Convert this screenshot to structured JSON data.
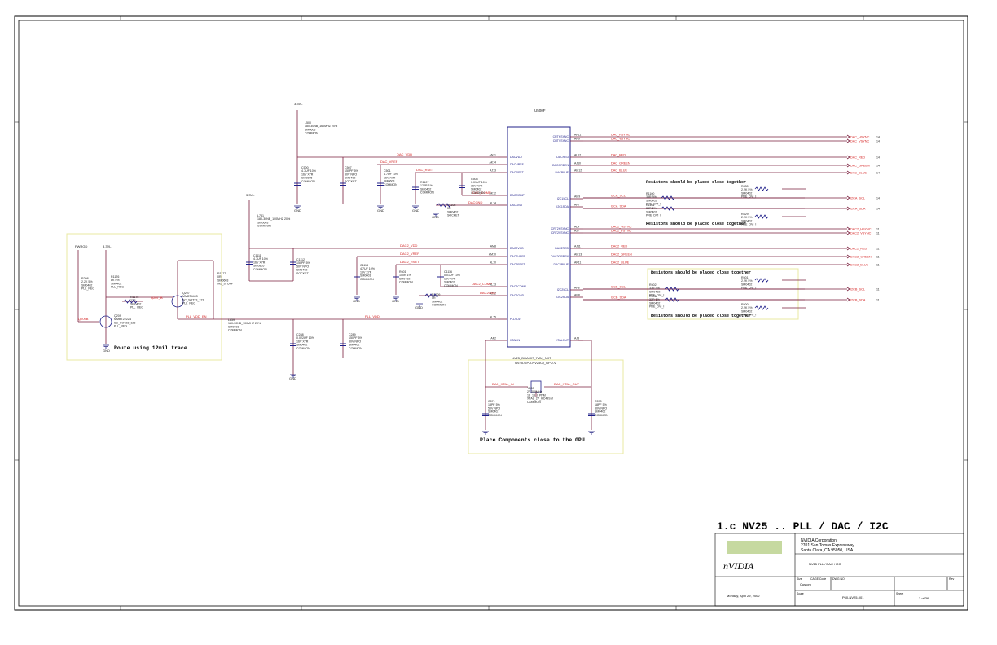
{
  "title_block": {
    "sheet_title": "1.c  NV25 .. PLL / DAC / I2C",
    "company": "NVIDIA Corporation",
    "address1": "2701 San Tomas Expressway",
    "address2": "Santa Clara, CA 95050, USA",
    "logo": "nVIDIA",
    "page_name": "NV25 PLL / DAC / I2C",
    "size_label": "Size",
    "size_value": "Custom",
    "cage_label": "CAGE Code",
    "dwg_label": "DWG NO",
    "rev_label": "Rev",
    "scale_label": "Scale",
    "date": "Monday, April 29, 2002",
    "dwg_value": "P60-NV25-001",
    "sheet_label": "Sheet",
    "sheet_value": "3   of   36"
  },
  "notes": {
    "route": "Route using 12mil trace.",
    "place": "Place Components close to the GPU",
    "resist1": "Resistors should be placed close together",
    "resist2": "Resistors should be placed close together",
    "resist3": "Resistors should be placed close together",
    "resist4": "Resistors should be placed close together"
  },
  "gpu": {
    "ref": "U500F",
    "part1": "NV25_BGA907_7MM_NKT",
    "part2": "NV25-GPU-NV2500_GPU-V",
    "left_pins": [
      {
        "num": "AN11",
        "name": "DACVDD"
      },
      {
        "num": "AK14",
        "name": "DACVREF"
      },
      {
        "num": "AJ13",
        "name": "DACRSET"
      },
      {
        "num": "AK12",
        "name": "DACCOMP"
      },
      {
        "num": "AL14",
        "name": "DACGND"
      },
      {
        "num": "AM8",
        "name": "DAC2VDD"
      },
      {
        "num": "AM10",
        "name": "DAC2VREF"
      },
      {
        "num": "AL10",
        "name": "DAC2RSET"
      },
      {
        "num": "AL13",
        "name": "DAC2COMP"
      },
      {
        "num": "AJ12",
        "name": "DAC2GND"
      },
      {
        "num": "AL15",
        "name": "PLLVDD"
      },
      {
        "num": "AP2",
        "name": "XTALIN"
      }
    ],
    "right_pins": [
      {
        "num": "AP11",
        "name": "CRTHSYNC"
      },
      {
        "num": "AN9",
        "name": "CRTVSYNC"
      },
      {
        "num": "AL12",
        "name": "DACRED"
      },
      {
        "num": "AJ10",
        "name": "DACGREEN"
      },
      {
        "num": "AM12",
        "name": "DACBLUE"
      },
      {
        "num": "AM9",
        "name": "I2C1SCL"
      },
      {
        "num": "AP7",
        "name": "I2C1SDA"
      },
      {
        "num": "AL4",
        "name": "CRT2HSYNC"
      },
      {
        "num": "AJ7",
        "name": "CRT2VSYNC"
      },
      {
        "num": "AJ11",
        "name": "DAC2RED"
      },
      {
        "num": "AM13",
        "name": "DAC2GREEN"
      },
      {
        "num": "AK11",
        "name": "DAC2BLUE"
      },
      {
        "num": "AP8",
        "name": "I2C2SCL"
      },
      {
        "num": "AN8",
        "name": "I2C2SDA"
      },
      {
        "num": "AJ8",
        "name": "XTALOUT"
      }
    ]
  },
  "outputs": [
    {
      "net": "DAC_HSYNC",
      "port": "DAC_HSYNC",
      "pg": "14"
    },
    {
      "net": "DAC_VSYNC",
      "port": "DAC_VSYNC",
      "pg": "14"
    },
    {
      "net": "DAC_RED",
      "port": "DAC_RED",
      "pg": "14"
    },
    {
      "net": "DAC_GREEN",
      "port": "DAC_GREEN",
      "pg": "14"
    },
    {
      "net": "DAC_BLUE",
      "port": "DAC_BLUE",
      "pg": "14"
    },
    {
      "net": "I2CA_SCL",
      "port": "I2CA_SCL",
      "pg": "14"
    },
    {
      "net": "I2CA_SDA",
      "port": "I2CA_SDA",
      "pg": "14"
    },
    {
      "net": "DAC2_HSYNC",
      "port": "DAC2_HSYNC",
      "pg": "11"
    },
    {
      "net": "DAC2_VSYNC",
      "port": "DAC2_VSYNC",
      "pg": "11"
    },
    {
      "net": "DAC2_RED",
      "port": "DAC2_RED",
      "pg": "11"
    },
    {
      "net": "DAC2_GREEN",
      "port": "DAC2_GREEN",
      "pg": "11"
    },
    {
      "net": "DAC2_BLUE",
      "port": "DAC2_BLUE",
      "pg": "11"
    },
    {
      "net": "I2CB_SCL",
      "port": "I2CB_SCL",
      "pg": "11"
    },
    {
      "net": "I2CB_SDA",
      "port": "I2CB_SDA",
      "pg": "11"
    }
  ],
  "nets": {
    "dac_vdd": "DAC_VDD",
    "dac_vref": "DAC_VREF",
    "dac_rset": "DAC_RSET",
    "dac_comp": "DAC_COMP",
    "dacgnd": "DACGND",
    "dac2_vdd": "DAC2_VDD",
    "dac2_vref": "DAC2_VREF",
    "dac2_rset": "DAC2_RSET",
    "dac2_comp": "DAC2_COMP",
    "dac2gnd": "DAC2GND",
    "pll_vdd": "PLL_VDD",
    "pll_vdd_en": "PLL_VDD_EN",
    "xtal_in": "DAC_XTAL_IN",
    "xtal_out": "DAC_XTAL_OUT",
    "pwrgd": "PWRGD",
    "q209b": "Q209B",
    "q207": "Q207_B",
    "p33v_a": "3.3VL",
    "p33v_b": "3.3VL",
    "p33v_c": "3.3VL",
    "p33v_d": "3.3VL",
    "pwrgd_port": "PWRGD",
    "gnd": "GND",
    "p5v": "5V",
    "sockel": "SOCKET",
    "common": "COMMON"
  },
  "components": {
    "l500": {
      "ref": "L500",
      "v": "180-30NB_160MHZ",
      "t": "20%",
      "p": "SM0603",
      "s": "COMMON"
    },
    "l731": {
      "ref": "L731",
      "v": "180-30NB_100MHZ",
      "t": "20%",
      "p": "SM0603",
      "s": "COMMON"
    },
    "l859": {
      "ref": "L859",
      "v": "180-30NB_100MHZ",
      "t": "20%",
      "p": "SM0603",
      "s": "COMMON"
    },
    "c500": {
      "ref": "C500",
      "v": "4.7UF",
      "t": "10%",
      "x": "16V  X7R",
      "p": "SM0805",
      "s": "COMMON"
    },
    "c507": {
      "ref": "C507",
      "v": "150PF",
      "t": "5%",
      "x": "50V  NPO",
      "p": "SM0402",
      "s": "SOCKET"
    },
    "c501": {
      "ref": "C501",
      "v": "4.7UF",
      "t": "10%",
      "x": "16V  X7R",
      "p": "SM0603",
      "s": "COMMON"
    },
    "r1107": {
      "ref": "R1107",
      "v": "124R",
      "t": "1%",
      "p": "SM0402",
      "s": "COMMON"
    },
    "c508": {
      "ref": "C508",
      "v": "0.01UF",
      "t": "10%",
      "x": "16V  X7R",
      "p": "SM0402",
      "s": "COMMON"
    },
    "r1108": {
      "ref": "R1108",
      "v": "0R",
      "p": "SM0402",
      "s": "SOCKET"
    },
    "c1111": {
      "ref": "C1111",
      "v": "4.7UF",
      "t": "10%",
      "x": "16V  X7R",
      "p": "SM0805",
      "s": "COMMON"
    },
    "c1112": {
      "ref": "C1112",
      "v": "150PF",
      "t": "5%",
      "x": "50V  NPO",
      "p": "SM0402",
      "s": "SOCKET"
    },
    "c1114": {
      "ref": "C1114",
      "v": "4.7UF",
      "t": "10%",
      "x": "16V  X7R",
      "p": "SM0603",
      "s": "COMMON"
    },
    "r601": {
      "ref": "R601",
      "v": "150R",
      "t": "1%",
      "p": "SM0402",
      "s": "COMMON"
    },
    "c1116": {
      "ref": "C1116",
      "v": "0.01UF",
      "t": "10%",
      "x": "16V  X7R",
      "p": "SM0402",
      "s": "COMMON"
    },
    "r1109": {
      "ref": "R1109",
      "v": "0R",
      "p": "SM0402",
      "s": "COMMON"
    },
    "c288": {
      "ref": "C288",
      "v": "0.022UF",
      "t": "10%",
      "x": "16V  X7R",
      "p": "SM0402",
      "s": "COMMON"
    },
    "c289": {
      "ref": "C289",
      "v": "150PF",
      "t": "5%",
      "x": "50V  NPO",
      "p": "SM0402",
      "s": "COMMON"
    },
    "r208": {
      "ref": "R208",
      "v": "2.2K",
      "t": "5%",
      "p": "SM0402",
      "s": "PLL_REG"
    },
    "r1176": {
      "ref": "R1176",
      "v": "8K",
      "t": "5%",
      "p": "SM0402",
      "s": "PLL_REG"
    },
    "r1175": {
      "ref": "R1175",
      "v": "22R",
      "p": "SM0402",
      "s": "PLL_REG"
    },
    "q209": {
      "ref": "Q209",
      "v": "MMBT2222A",
      "p": "SC_SOT23_123",
      "s": "PLL_REG"
    },
    "q207": {
      "ref": "Q207",
      "v": "MMBT4403",
      "p": "SC_SOT23_123",
      "s": "PLL_REG"
    },
    "r1177": {
      "ref": "R1177",
      "v": "0R",
      "p": "SM0603",
      "s": "NO_STUFF"
    },
    "c571": {
      "ref": "C571",
      "v": "18PF",
      "t": "5%",
      "x": "50V  NPO",
      "p": "SM0402",
      "s": "COMMON"
    },
    "c570": {
      "ref": "C570",
      "v": "18PF",
      "t": "5%",
      "x": "50V  NPO",
      "p": "SM0402",
      "s": "COMMON"
    },
    "y500": {
      "ref": "Y500",
      "v": "27.000MHz",
      "p": "XTAL_2P_HC49SM",
      "x": "13_15_0 PPM",
      "s": "COMMON"
    },
    "r1100": {
      "ref": "R1100",
      "v": "33R",
      "t": "5%",
      "p": "SM0402",
      "s": "PRE_DVI_I"
    },
    "r1101": {
      "ref": "R1101",
      "v": "33R",
      "t": "5%",
      "p": "SM0402",
      "s": "PRE_DVI_I"
    },
    "r830": {
      "ref": "R830",
      "v": "2.2K",
      "t": "5%",
      "p": "SM0402",
      "s": "PRE_DVI_I"
    },
    "r829": {
      "ref": "R829",
      "v": "2.2K",
      "t": "5%",
      "p": "SM0402",
      "s": "PRE_DVI_I"
    },
    "r502": {
      "ref": "R502",
      "v": "33R",
      "t": "5%",
      "p": "SM0402",
      "s": "PRE_DVI_I"
    },
    "r503": {
      "ref": "R503",
      "v": "33R",
      "t": "5%",
      "p": "SM0402",
      "s": "PRE_DVI_I"
    },
    "r501": {
      "ref": "R501",
      "v": "2.2K",
      "t": "5%",
      "p": "SM0402",
      "s": "PRE_DVI_I"
    },
    "r500": {
      "ref": "R500",
      "v": "2.2K",
      "t": "5%",
      "p": "SM0402",
      "s": "PRE_DVI_I"
    }
  },
  "colors": {
    "wire": "#7a1f3d",
    "net": "#d42020",
    "part": "#20208a",
    "gnd": "#202080",
    "frame": "#000000",
    "note_box": "#e8e8a0"
  }
}
